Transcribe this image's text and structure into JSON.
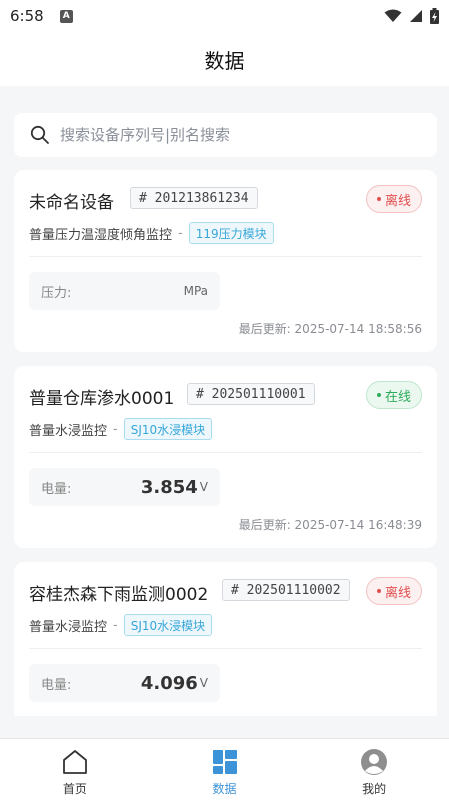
{
  "status_bar": {
    "time": "6:58",
    "notif_letter": "A"
  },
  "header": {
    "title": "数据"
  },
  "search": {
    "placeholder": "搜索设备序列号|别名搜索"
  },
  "devices": [
    {
      "name": "未命名设备",
      "serial": "# 201213861234",
      "status": "离线",
      "status_kind": "offline",
      "type": "普量压力温湿度倾角监控",
      "separator": "-",
      "module": "119压力模块",
      "metric_label": "压力:",
      "metric_value": "",
      "metric_unit": "MPa",
      "updated": "最后更新: 2025-07-14 18:58:56"
    },
    {
      "name": "普量仓库渗水0001",
      "serial": "# 202501110001",
      "status": "在线",
      "status_kind": "online",
      "type": "普量水浸监控",
      "separator": "-",
      "module": "SJ10水浸模块",
      "metric_label": "电量:",
      "metric_value": "3.854",
      "metric_unit": "V",
      "updated": "最后更新: 2025-07-14 16:48:39"
    },
    {
      "name": "容桂杰森下雨监测0002",
      "serial": "# 202501110002",
      "status": "离线",
      "status_kind": "offline",
      "type": "普量水浸监控",
      "separator": "-",
      "module": "SJ10水浸模块",
      "metric_label": "电量:",
      "metric_value": "4.096",
      "metric_unit": "V",
      "updated": ""
    }
  ],
  "tabs": [
    {
      "label": "首页",
      "icon": "home-icon",
      "active": false
    },
    {
      "label": "数据",
      "icon": "data-grid-icon",
      "active": true
    },
    {
      "label": "我的",
      "icon": "profile-avatar-icon",
      "active": false
    }
  ],
  "colors": {
    "accent": "#3c93d8",
    "offline": "#e0504f",
    "online": "#2eaa5c",
    "module_tag": "#38a6d8"
  }
}
